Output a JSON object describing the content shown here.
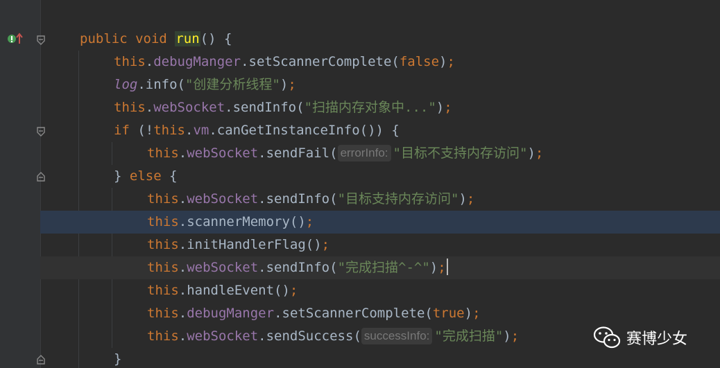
{
  "code": {
    "line_public": {
      "kw1": "public",
      "kw2": "void",
      "fn": "run",
      "tail": "() {"
    },
    "line_1": {
      "this": "this",
      "field": "debugManger",
      "call": ".setScannerComplete(",
      "arg": "false",
      "close": ")",
      "semi": ";"
    },
    "line_2": {
      "obj": "log",
      "call": ".info(",
      "arg": "\"创建分析线程\"",
      "close": ")",
      "semi": ";"
    },
    "line_3": {
      "this": "this",
      "field": "webSocket",
      "call": ".sendInfo(",
      "arg": "\"扫描内存对象中...\"",
      "close": ")",
      "semi": ";"
    },
    "line_4": {
      "kw": "if",
      "open": " (!",
      "this": "this",
      "field": "vm",
      "call": ".canGetInstanceInfo()) {"
    },
    "line_5": {
      "this": "this",
      "field": "webSocket",
      "call": ".sendFail(",
      "hint": "errorInfo:",
      "arg": "\"目标不支持内存访问\"",
      "close": ")",
      "semi": ";"
    },
    "line_6": {
      "brace": "} ",
      "kw": "else",
      "tail": " {"
    },
    "line_7": {
      "this": "this",
      "field": "webSocket",
      "call": ".sendInfo(",
      "arg": "\"目标支持内存访问\"",
      "close": ")",
      "semi": ";"
    },
    "line_8": {
      "this": "this",
      "call": ".scannerMemory()",
      "semi": ";"
    },
    "line_9": {
      "this": "this",
      "call": ".initHandlerFlag()",
      "semi": ";"
    },
    "line_10": {
      "this": "this",
      "field": "webSocket",
      "call": ".sendInfo(",
      "arg": "\"完成扫描^-^\"",
      "close": ")",
      "semi": ";"
    },
    "line_11": {
      "this": "this",
      "call": ".handleEvent()",
      "semi": ";"
    },
    "line_12": {
      "this": "this",
      "field": "debugManger",
      "call": ".setScannerComplete(",
      "arg": "true",
      "close": ")",
      "semi": ";"
    },
    "line_13": {
      "this": "this",
      "field": "webSocket",
      "call": ".sendSuccess(",
      "hint": "successInfo:",
      "arg": "\"完成扫描\"",
      "close": ")",
      "semi": ";"
    },
    "line_14": {
      "brace": "}"
    }
  },
  "gutter_icons": {
    "override": "override-icon",
    "bulb": "lightbulb-icon",
    "fold": "fold-marker-icon"
  },
  "watermark": {
    "text": "赛博少女",
    "icon": "wechat-icon"
  },
  "colors": {
    "background": "#2b2b2b",
    "keyword": "#cc7832",
    "field": "#9876aa",
    "string": "#6a8759",
    "text": "#a9b7c6",
    "selected_line": "#2d3a4d"
  }
}
